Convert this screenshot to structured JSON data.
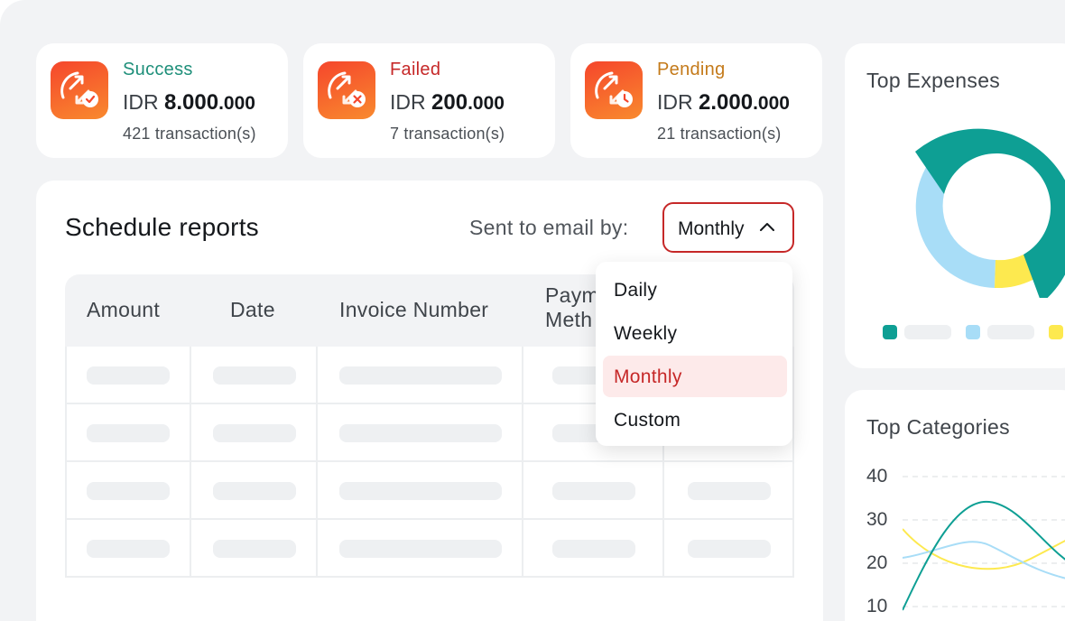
{
  "colors": {
    "success": "#1e8f7a",
    "failed": "#c62828",
    "pending": "#c47a1a",
    "teal": "#0e9f94",
    "light_blue": "#a8ddf7",
    "yellow": "#fde94f",
    "accent_red": "#c62828"
  },
  "stats": [
    {
      "status": "Success",
      "currency": "IDR",
      "amount_major": "8.000",
      "amount_minor": ".000",
      "count": "421 transaction(s)",
      "icon": "transfer-check-icon"
    },
    {
      "status": "Failed",
      "currency": "IDR",
      "amount_major": "200",
      "amount_minor": ".000",
      "count": "7 transaction(s)",
      "icon": "transfer-cross-icon"
    },
    {
      "status": "Pending",
      "currency": "IDR",
      "amount_major": "2.000",
      "amount_minor": ".000",
      "count": "21 transaction(s)",
      "icon": "transfer-clock-icon"
    }
  ],
  "schedule": {
    "title": "Schedule reports",
    "sent_label": "Sent to email by:",
    "selected": "Monthly",
    "columns": [
      "Amount",
      "Date",
      "Invoice Number",
      "Paym",
      "Meth"
    ],
    "options": [
      "Daily",
      "Weekly",
      "Monthly",
      "Custom"
    ],
    "active_option": "Monthly"
  },
  "expenses": {
    "title": "Top Expenses"
  },
  "categories": {
    "title": "Top Categories",
    "y_ticks": [
      "40",
      "30",
      "20",
      "10"
    ]
  }
}
